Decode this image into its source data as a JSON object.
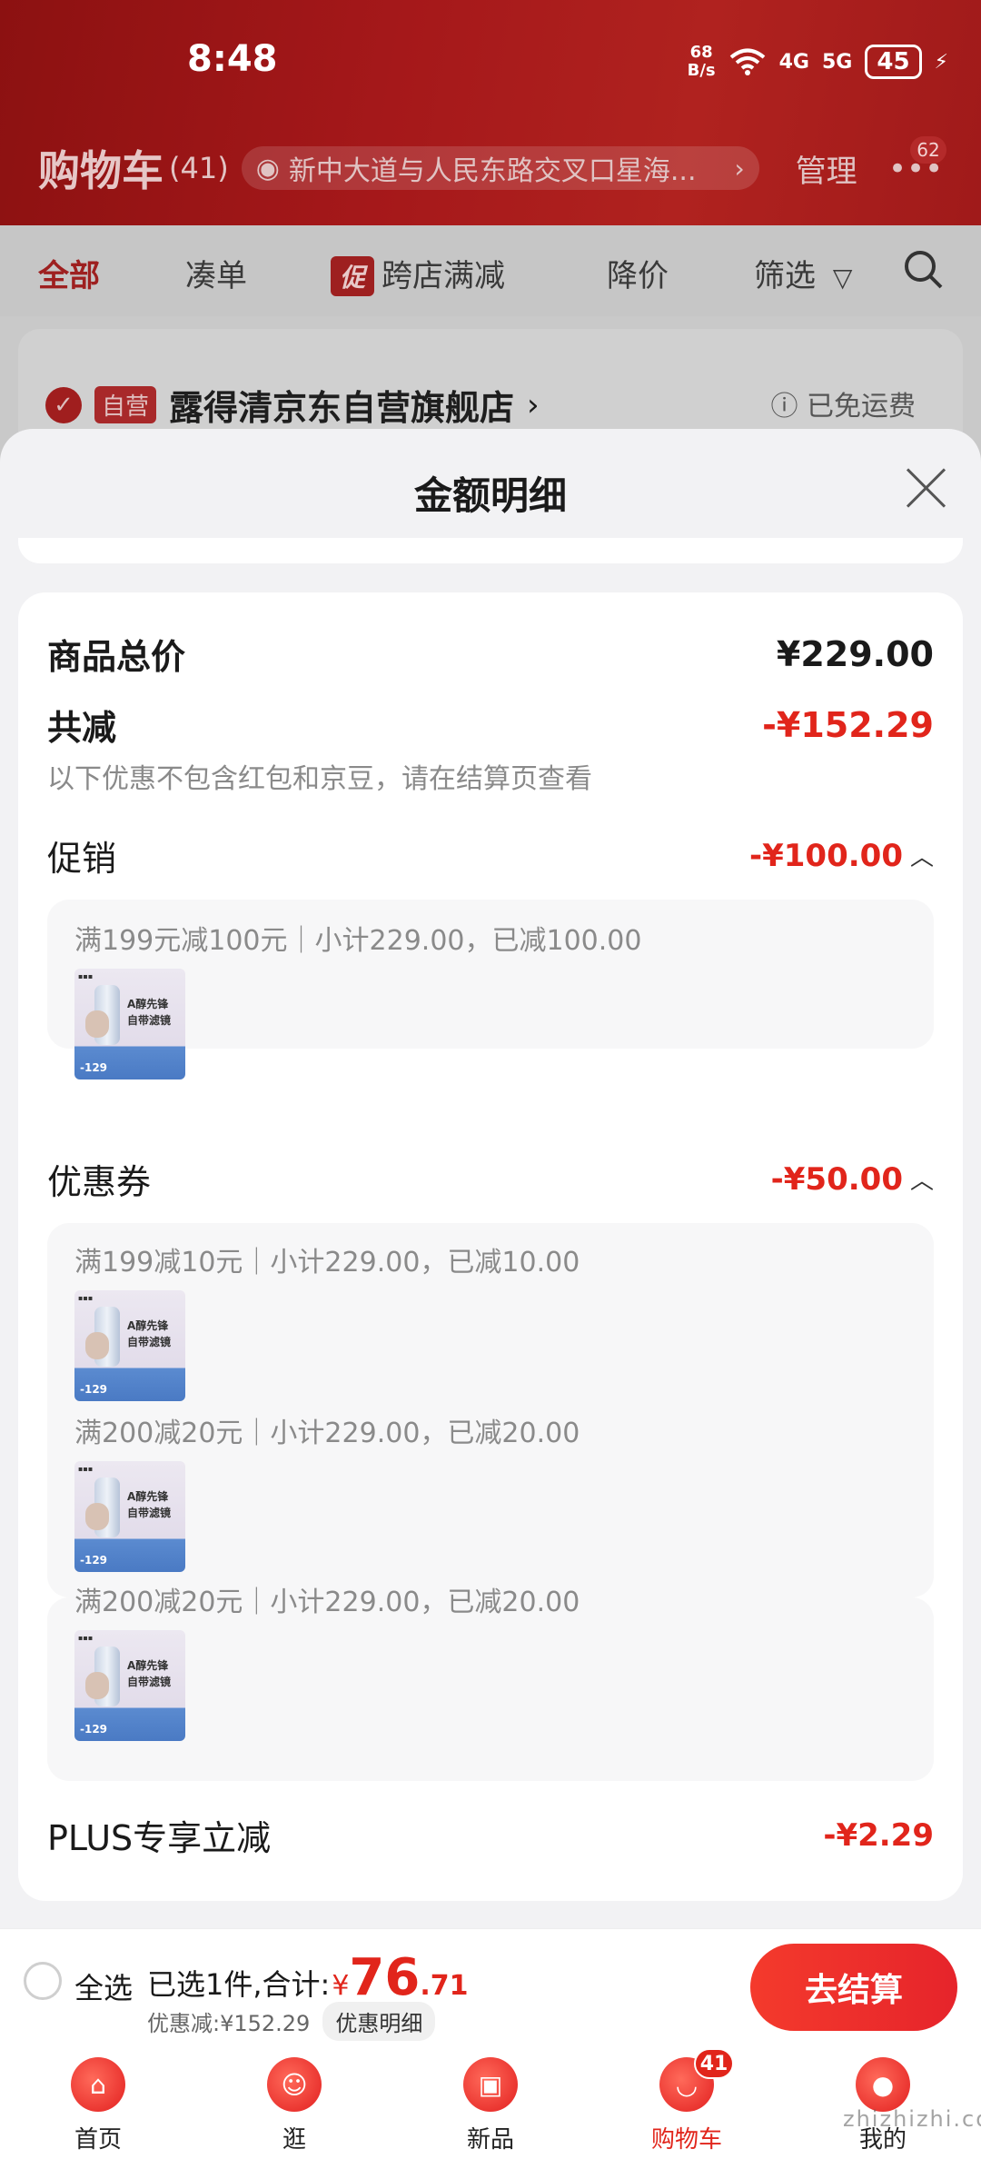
{
  "status_bar": {
    "time": "8:48",
    "net_speed_value": "68",
    "net_speed_unit": "B/s",
    "signal_1": "4G",
    "signal_2": "5G",
    "battery": "45"
  },
  "header": {
    "title": "购物车",
    "count": "(41)",
    "address": "新中大道与人民东路交叉口星海...",
    "manage": "管理",
    "more_badge": "62"
  },
  "filters": {
    "all": "全部",
    "combine": "凑单",
    "promo_tag": "促",
    "cross_store": "跨店满减",
    "price_drop": "降价",
    "filter": "筛选"
  },
  "store": {
    "self_tag": "自营",
    "name": "露得清京东自营旗舰店",
    "shipping": "已免运费"
  },
  "sheet": {
    "title": "金额明细",
    "total_label": "商品总价",
    "total_value": "¥229.00",
    "reduce_label": "共减",
    "reduce_value": "-¥152.29",
    "reduce_note": "以下优惠不包含红包和京豆，请在结算页查看",
    "promotion_label": "促销",
    "promotion_value": "-¥100.00",
    "promotion_items": [
      {
        "text": "满199元减100元｜小计229.00，已减100.00"
      }
    ],
    "coupon_label": "优惠券",
    "coupon_value": "-¥50.00",
    "coupon_items": [
      {
        "text": "满199减10元｜小计229.00，已减10.00"
      },
      {
        "text": "满200减20元｜小计229.00，已减20.00"
      },
      {
        "text": "满200减20元｜小计229.00，已减20.00"
      }
    ],
    "plus_label": "PLUS专享立减",
    "plus_value": "-¥2.29",
    "thumb": {
      "line1": "A醇先锋",
      "line2": "自带滤镜",
      "price": "-129"
    }
  },
  "checkout": {
    "select_all": "全选",
    "summary": "已选1件,合计:",
    "currency": "¥",
    "amount_int": "76",
    "amount_dec": ".71",
    "discount": "优惠减:¥152.29",
    "detail_button": "优惠明细",
    "checkout_button": "去结算"
  },
  "tabbar": {
    "home": "首页",
    "browse": "逛",
    "new": "新品",
    "cart": "购物车",
    "cart_badge": "41",
    "mine": "我的"
  },
  "watermark": "zhizhizhi.com",
  "colors": {
    "accent": "#e1251b",
    "header_bg": "#a5181a"
  }
}
